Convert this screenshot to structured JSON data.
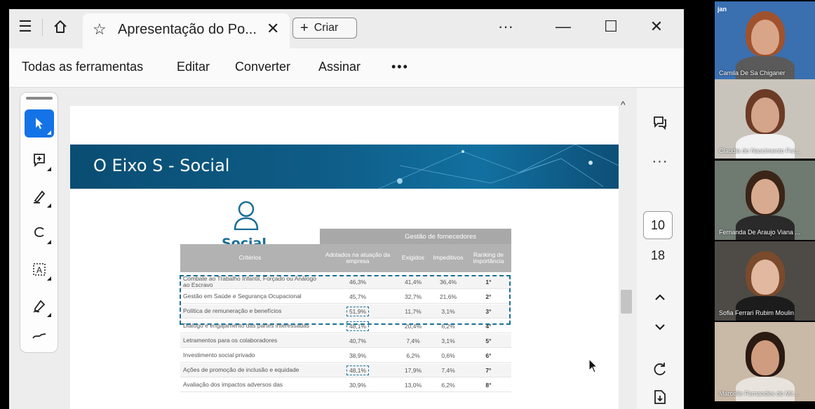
{
  "app": {
    "tab_title": "Apresentação do Po...",
    "create_label": "Criar",
    "more_label": "···",
    "menu": [
      "Todas as ferramentas",
      "Editar",
      "Converter",
      "Assinar",
      "•••"
    ]
  },
  "right_panel": {
    "current_page": "10",
    "total_pages": "18",
    "more_label": "···"
  },
  "slide": {
    "banner_title": "O Eixo S - Social",
    "section_label": "Social",
    "table": {
      "group_header": "Gestão de fornecedores",
      "headers": [
        "Critérios",
        "Adotados na atuação da empresa",
        "Exigidos",
        "Impeditivos",
        "Ranking de importância"
      ],
      "rows": [
        {
          "criterio": "Combate ao Trabalho Infantil, Forçado ou Análogo ao Escravo",
          "adotados": "46,3%",
          "exigidos": "41,4%",
          "impeditivos": "36,4%",
          "ranking": "1°"
        },
        {
          "criterio": "Gestão em Saúde e Segurança Ocupacional",
          "adotados": "45,7%",
          "exigidos": "32,7%",
          "impeditivos": "21,6%",
          "ranking": "2°"
        },
        {
          "criterio": "Política de remuneração e benefícios",
          "adotados": "51,9%",
          "exigidos": "11,7%",
          "impeditivos": "3,1%",
          "ranking": "3°"
        },
        {
          "criterio": "Diálogo e engajamento das partes interessadas",
          "adotados": "48,1%",
          "exigidos": "20,4%",
          "impeditivos": "6,2%",
          "ranking": "4°"
        },
        {
          "criterio": "Letramentos para os colaboradores",
          "adotados": "40,7%",
          "exigidos": "7,4%",
          "impeditivos": "3,1%",
          "ranking": "5°"
        },
        {
          "criterio": "Investimento social privado",
          "adotados": "38,9%",
          "exigidos": "6,2%",
          "impeditivos": "0,6%",
          "ranking": "6°"
        },
        {
          "criterio": "Ações de promoção de inclusão e equidade",
          "adotados": "48,1%",
          "exigidos": "17,9%",
          "impeditivos": "7,4%",
          "ranking": "7°"
        },
        {
          "criterio": "Avaliação dos impactos adversos das",
          "adotados": "30,9%",
          "exigidos": "13,0%",
          "impeditivos": "6,2%",
          "ranking": "8°"
        }
      ]
    }
  },
  "participants": [
    {
      "name": "Camila De Sa Chiganer",
      "bg": "#3a6fb0",
      "skin": "#d9a589",
      "hair": "#a0522d",
      "shirt": "#5a5a5a",
      "logo": "jan"
    },
    {
      "name": "Claudia do Nascimento Far...",
      "bg": "#c9c4bb",
      "skin": "#d4a58a",
      "hair": "#6b3b26",
      "shirt": "#f2f2f2"
    },
    {
      "name": "Fernanda De Araujo Viana ...",
      "bg": "#6f7a70",
      "skin": "#d8ab90",
      "hair": "#3b2418",
      "shirt": "#2a2a2a"
    },
    {
      "name": "Sofia Ferrari Rubim Moulin",
      "bg": "#4e4a46",
      "skin": "#e2b8a0",
      "hair": "#7a4a2c",
      "shirt": "#1c1c1c"
    },
    {
      "name": "Marcelle Fernandes de Mir...",
      "bg": "#c9b9a7",
      "skin": "#cf9c80",
      "hair": "#2a1a12",
      "shirt": "#e8e3dc"
    }
  ]
}
